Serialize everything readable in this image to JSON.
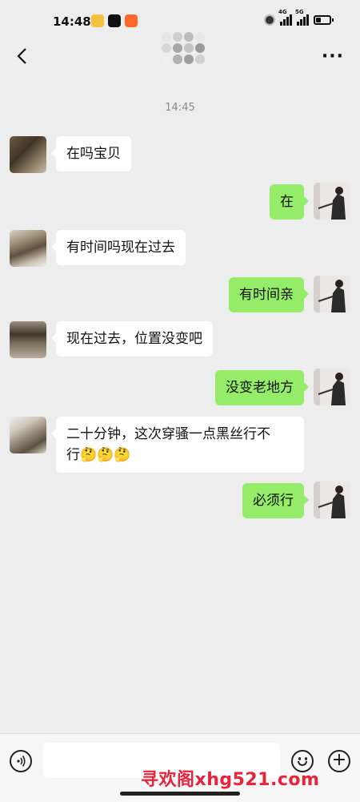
{
  "status": {
    "time": "14:48",
    "net1": "4G",
    "net2": "5G"
  },
  "header": {
    "back_icon": "back-arrow-icon",
    "more_icon": "more-dots-icon",
    "more_label": "···"
  },
  "chat": {
    "timestamp": "14:45",
    "messages": [
      {
        "side": "in",
        "text": "在吗宝贝"
      },
      {
        "side": "out",
        "text": "在"
      },
      {
        "side": "in",
        "text": "有时间吗现在过去"
      },
      {
        "side": "out",
        "text": "有时间亲"
      },
      {
        "side": "in",
        "text": "现在过去，位置没变吧"
      },
      {
        "side": "out",
        "text": "没变老地方"
      },
      {
        "side": "in",
        "text_line1": "二十分钟，这次穿骚一点黑丝行不",
        "text_line2": "行",
        "emoji": "🤔🤔🤔"
      },
      {
        "side": "out",
        "text": "必须行"
      }
    ]
  },
  "input_bar": {
    "message_value": "",
    "voice_icon": "voice-icon",
    "emoji_icon": "emoji-icon",
    "plus_icon": "plus-icon"
  },
  "watermark": "寻欢阁xhg521.com",
  "colors": {
    "outgoing_bubble": "#95ec69",
    "incoming_bubble": "#ffffff",
    "background": "#ededed",
    "watermark": "#e8233a"
  }
}
